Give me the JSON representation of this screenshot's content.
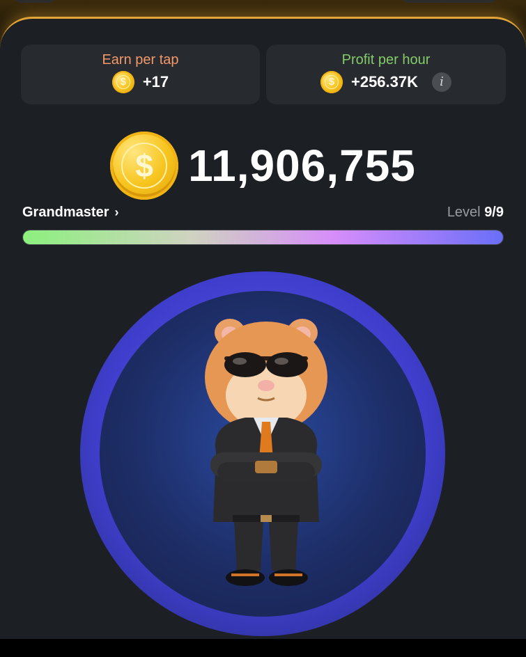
{
  "stats": {
    "earn_label": "Earn per tap",
    "earn_value": "+17",
    "profit_label": "Profit per hour",
    "profit_value": "+256.37K",
    "coin_symbol": "$",
    "info_symbol": "i"
  },
  "balance": {
    "value": "11,906,755",
    "coin_symbol": "$"
  },
  "rank": {
    "name": "Grandmaster",
    "chevron": "›",
    "level_label": "Level",
    "level_value": "9/9",
    "progress_fraction": 1.0
  },
  "colors": {
    "accent_gold": "#e2a536",
    "earn_label": "#f2996a",
    "profit_label": "#84cb69",
    "progress_start": "#8cf07e",
    "progress_end": "#6a6ef9",
    "ring": "#4b4ae0"
  },
  "icons": {
    "coin": "coin-icon",
    "info": "info-icon",
    "chevron": "chevron-right-icon",
    "character": "hamster-ceo-character"
  }
}
